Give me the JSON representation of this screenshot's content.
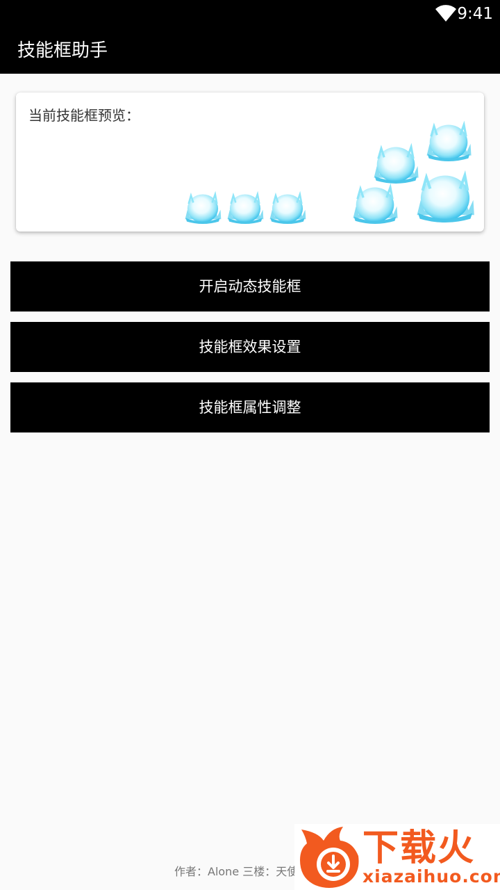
{
  "status_bar": {
    "time": "9:41",
    "wifi_icon": "wifi-icon"
  },
  "app_bar": {
    "title": "技能框助手"
  },
  "preview": {
    "label": "当前技能框预览：",
    "orb_icon": "ice-orb-icon",
    "orb_color": "#5fd6f5"
  },
  "actions": {
    "start_dynamic": "开启动态技能框",
    "effect_settings": "技能框效果设置",
    "attribute_adjust": "技能框属性调整"
  },
  "footer": {
    "credits": "作者：Alone 三楼：天使"
  },
  "watermark": {
    "title": "下载火",
    "domain": "xiazaihuo.com",
    "brand_color": "#f25a1f"
  }
}
